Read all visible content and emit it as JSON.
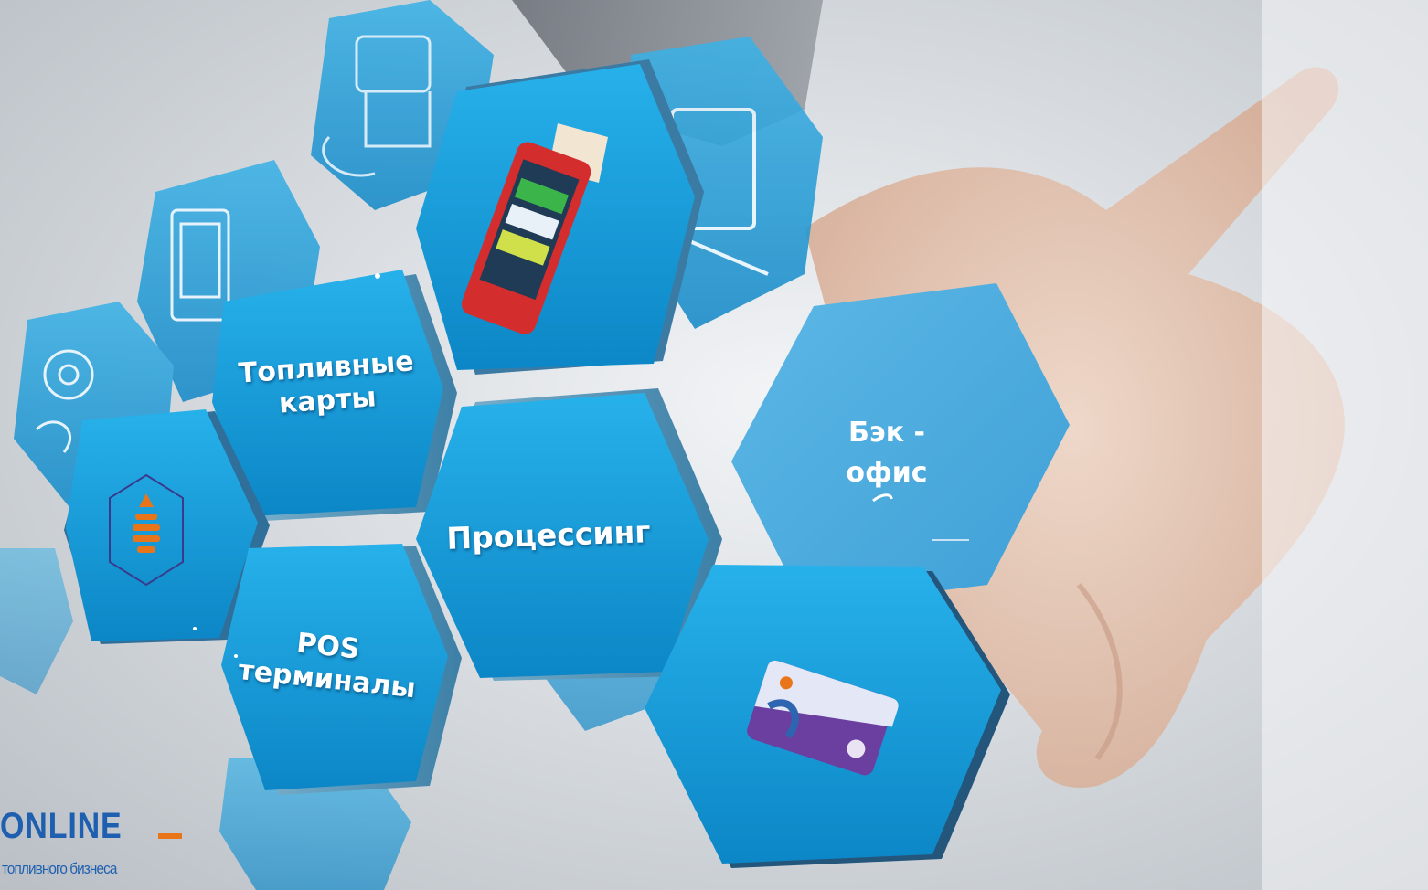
{
  "hexagons": {
    "fuel_cards": "Топливные\nкарты",
    "pos_terminals": "POS\nтерминалы",
    "processing": "Процессинг",
    "back_office": "Бэк -\nофис"
  },
  "logo": {
    "name": "ONLINE",
    "tagline": "топливного бизнеса",
    "accent_color": "#e8751a",
    "text_color": "#1f5fb0"
  },
  "icons": [
    "oil-drop-hex-icon",
    "pos-terminal-image",
    "fuel-card-image",
    "monitor-sketch-icon",
    "tablet-sketch-icon",
    "hand-pump-sketch-icon"
  ],
  "colors": {
    "hex_blue": "#1aa0dc",
    "hex_blue_dark": "#0b79b6",
    "back_office_blue": "#4aaee0"
  }
}
